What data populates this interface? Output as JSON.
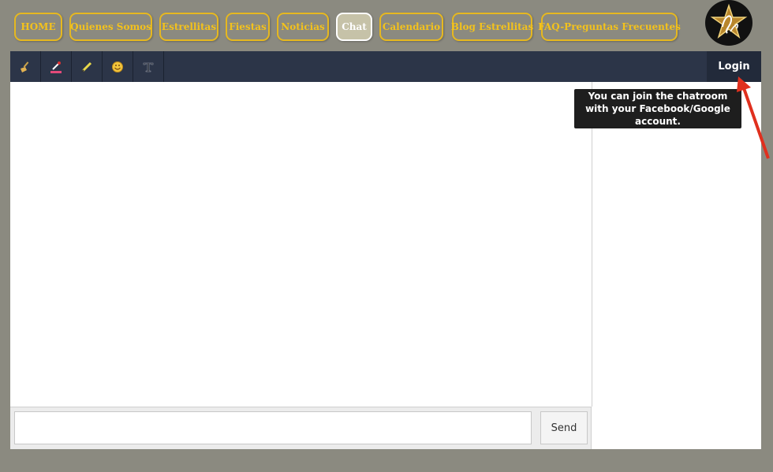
{
  "nav": {
    "items": [
      {
        "label": "HOME"
      },
      {
        "label": "Quienes Somos"
      },
      {
        "label": "Estrellitas"
      },
      {
        "label": "Fiestas"
      },
      {
        "label": "Noticias"
      },
      {
        "label": "Chat",
        "active": true
      },
      {
        "label": "Calendario"
      },
      {
        "label": "Blog Estrellitas"
      },
      {
        "label": "FAQ-Preguntas Frecuentes"
      }
    ]
  },
  "logo": {
    "icon": "star-logo-icon"
  },
  "toolbar": {
    "tools": [
      {
        "icon": "clear-broom-icon"
      },
      {
        "icon": "text-color-dropper-icon"
      },
      {
        "icon": "highlight-pencil-icon"
      },
      {
        "icon": "emoji-icon"
      },
      {
        "icon": "text-format-icon"
      }
    ],
    "login_label": "Login"
  },
  "composer": {
    "placeholder": "",
    "send_label": "Send"
  },
  "tooltip": {
    "text": "You can join the chatroom with your Facebook/Google account."
  },
  "colors": {
    "page_bg": "#8b8a80",
    "nav_text": "#f3c21c",
    "toolbar_bg": "#2c3548",
    "annotation_arrow": "#e0301e"
  }
}
